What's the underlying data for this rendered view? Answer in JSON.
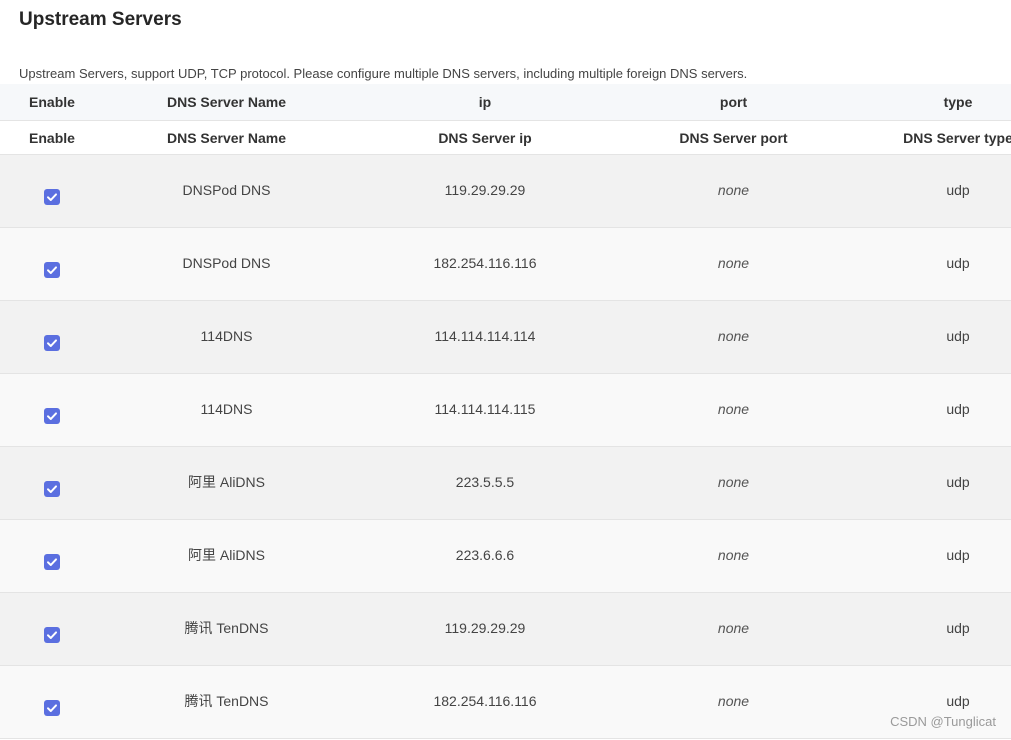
{
  "section": {
    "title": "Upstream Servers",
    "description": "Upstream Servers, support UDP, TCP protocol. Please configure multiple DNS servers, including multiple foreign DNS servers."
  },
  "table": {
    "headers": [
      "Enable",
      "DNS Server Name",
      "ip",
      "port",
      "type"
    ],
    "column_titles": [
      "Enable",
      "DNS Server Name",
      "DNS Server ip",
      "DNS Server port",
      "DNS Server type"
    ],
    "rows": [
      {
        "enabled": true,
        "name": "DNSPod DNS",
        "ip": "119.29.29.29",
        "port": "none",
        "type": "udp"
      },
      {
        "enabled": true,
        "name": "DNSPod DNS",
        "ip": "182.254.116.116",
        "port": "none",
        "type": "udp"
      },
      {
        "enabled": true,
        "name": "114DNS",
        "ip": "114.114.114.114",
        "port": "none",
        "type": "udp"
      },
      {
        "enabled": true,
        "name": "114DNS",
        "ip": "114.114.114.115",
        "port": "none",
        "type": "udp"
      },
      {
        "enabled": true,
        "name": "阿里 AliDNS",
        "ip": "223.5.5.5",
        "port": "none",
        "type": "udp"
      },
      {
        "enabled": true,
        "name": "阿里 AliDNS",
        "ip": "223.6.6.6",
        "port": "none",
        "type": "udp"
      },
      {
        "enabled": true,
        "name": "腾讯 TenDNS",
        "ip": "119.29.29.29",
        "port": "none",
        "type": "udp"
      },
      {
        "enabled": true,
        "name": "腾讯 TenDNS",
        "ip": "182.254.116.116",
        "port": "none",
        "type": "udp"
      }
    ]
  },
  "watermark": "CSDN @Tunglicat",
  "colors": {
    "checkbox_accent": "#5b6fe0",
    "header_bg": "#f6f8fa",
    "row_odd_bg": "#f2f2f2",
    "row_even_bg": "#f9f9f9"
  },
  "icons": {
    "enable": "checkbox-checked-icon"
  }
}
